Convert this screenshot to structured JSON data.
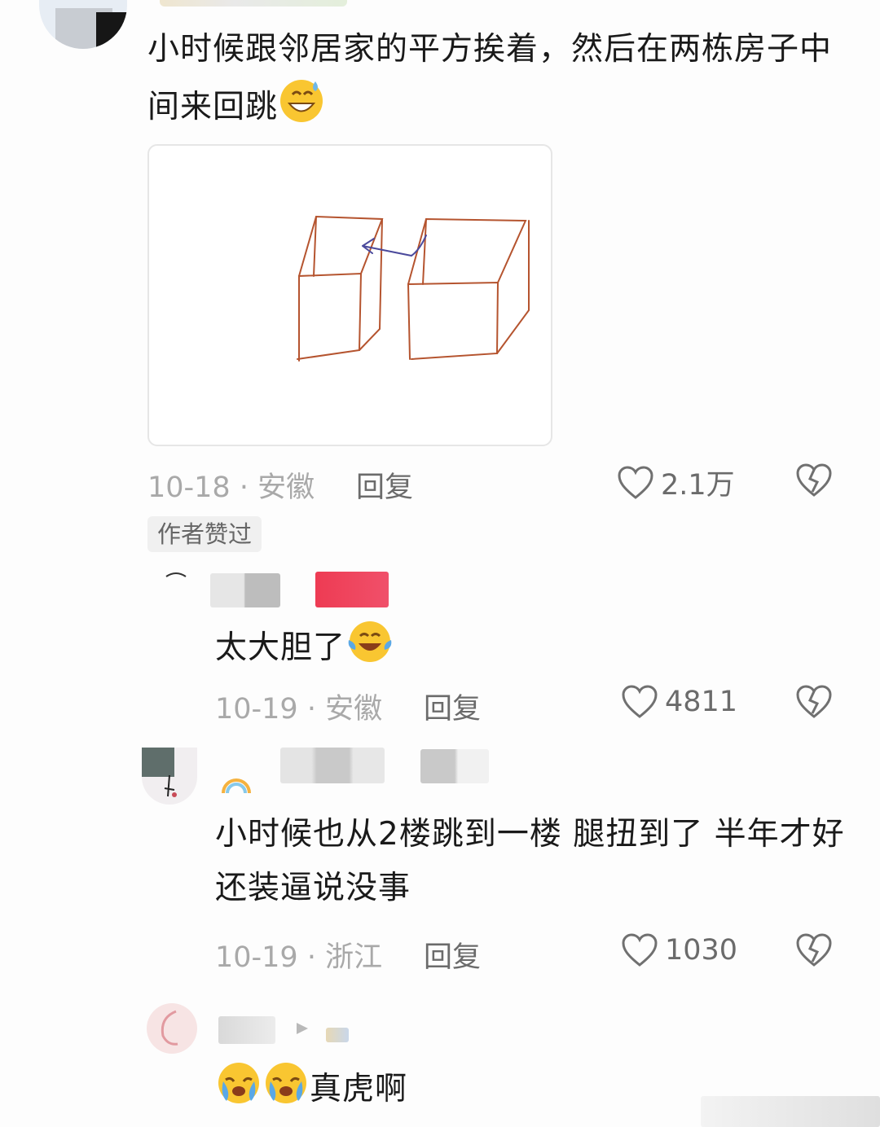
{
  "comments": [
    {
      "text": "小时候跟邻居家的平方挨着，然后在两栋房子中间来回跳",
      "date": "10-18",
      "location": "安徽",
      "reply_label": "回复",
      "likes": "2.1万",
      "badge": "作者赞过",
      "emoji": "grinning-sweat-emoji"
    },
    {
      "text": "太大胆了",
      "date": "10-19",
      "location": "安徽",
      "reply_label": "回复",
      "likes": "4811",
      "emoji": "tears-of-joy-emoji"
    },
    {
      "text": "小时候也从2楼跳到一楼 腿扭到了 半年才好 还装逼说没事",
      "date": "10-19",
      "location": "浙江",
      "reply_label": "回复",
      "likes": "1030"
    },
    {
      "text": "真虎啊",
      "emoji": "crying-face-emoji"
    }
  ],
  "separator": "·",
  "colors": {
    "drawing_stroke": "#b5542f",
    "arrow_stroke": "#4b4a9c",
    "red_tag": "#ee3b53"
  }
}
